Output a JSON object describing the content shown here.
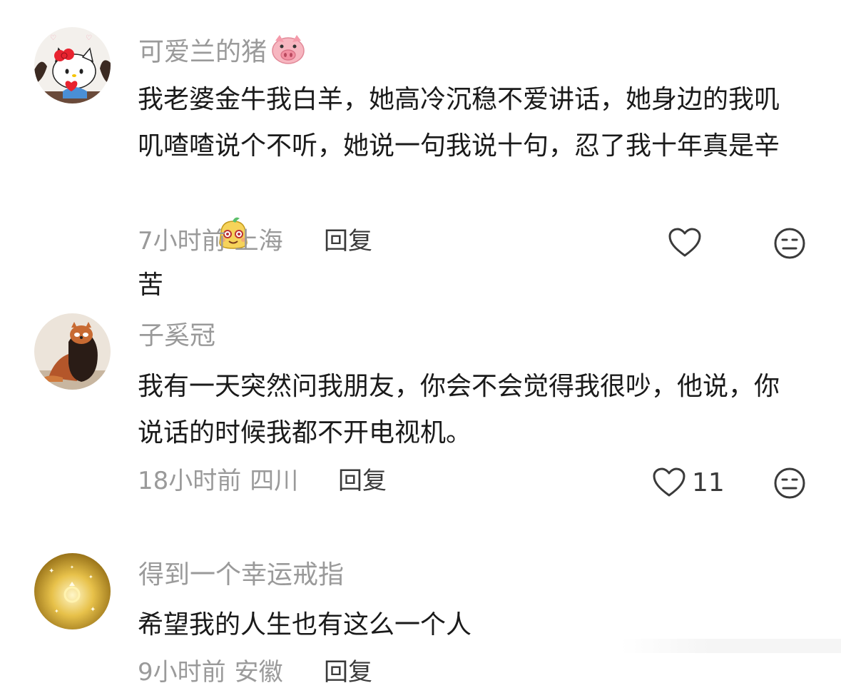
{
  "comments": [
    {
      "username": "可爱兰的猪",
      "username_emoji": "pig-face",
      "content": "我老婆金牛我白羊，她高冷沉稳不爱讲话，她身边的我叽叽喳喳说个不听，她说一句我说十句，忍了我十年真是辛苦",
      "content_emoji": "cute-face",
      "time": "7小时前",
      "location": "上海",
      "reply_label": "回复",
      "like_count": ""
    },
    {
      "username": "子奚冠",
      "content": "我有一天突然问我朋友，你会不会觉得我很吵，他说，你说话的时候我都不开电视机。",
      "time": "18小时前",
      "location": "四川",
      "reply_label": "回复",
      "like_count": "11"
    },
    {
      "username": "得到一个幸运戒指",
      "content": "希望我的人生也有这么一个人",
      "time": "9小时前",
      "location": "安徽",
      "reply_label": "回复",
      "like_count": ""
    }
  ],
  "colors": {
    "username": "#9a9a9a",
    "content": "#1a1a1a",
    "meta": "#9a9a9a",
    "action": "#3a3a3a"
  },
  "icons": {
    "like": "heart-outline-icon",
    "dislike": "meh-face-icon"
  }
}
